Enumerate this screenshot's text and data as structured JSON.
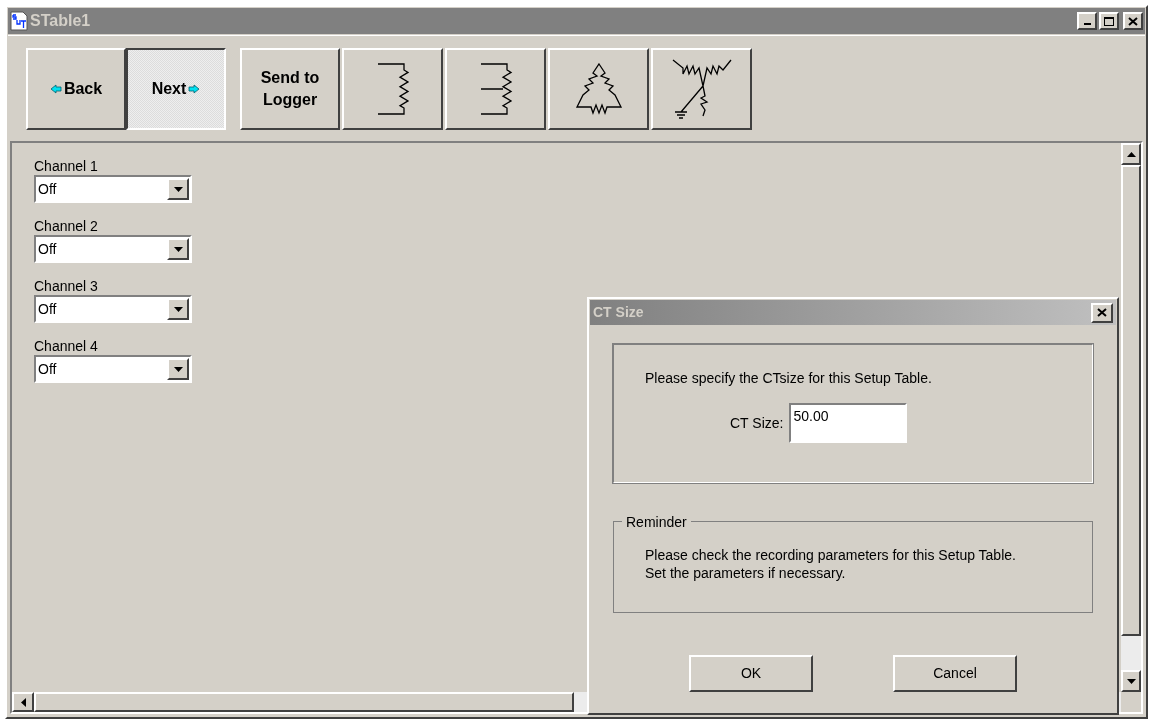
{
  "window": {
    "title": "STable1"
  },
  "toolbar": {
    "nav_buttons": [
      {
        "kind": "back",
        "label": "Back",
        "selected": false
      },
      {
        "kind": "next",
        "label": "Next",
        "selected": true
      }
    ],
    "send_button": {
      "label_lines": [
        "Send to",
        "Logger"
      ]
    },
    "circuit_buttons": [
      {
        "kind": "single"
      },
      {
        "kind": "tapped"
      },
      {
        "kind": "delta"
      },
      {
        "kind": "wye"
      }
    ]
  },
  "channels": [
    {
      "label": "Channel 1",
      "value": "Off"
    },
    {
      "label": "Channel 2",
      "value": "Off"
    },
    {
      "label": "Channel 3",
      "value": "Off"
    },
    {
      "label": "Channel 4",
      "value": "Off"
    }
  ],
  "dialog": {
    "title": "CT Size",
    "message": "Please specify the CTsize for this Setup Table.",
    "field_label": "CT Size:",
    "field_value": "50.00",
    "reminder": {
      "legend": "Reminder",
      "text": "Please check the recording parameters for this Setup Table. Set the parameters if necessary."
    },
    "buttons": [
      "OK",
      "Cancel"
    ]
  }
}
